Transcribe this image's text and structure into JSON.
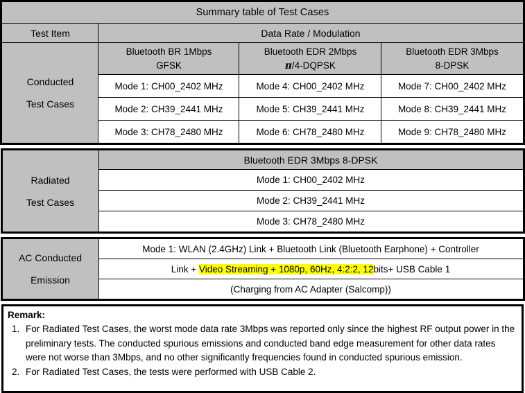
{
  "document": {
    "title": "Summary table of Test Cases"
  },
  "conducted_table": {
    "header": {
      "test_item_label": "Test Item",
      "data_rate_label": "Data Rate / Modulation"
    },
    "row_label": {
      "line1": "Conducted",
      "line2": "Test Cases"
    },
    "columns": [
      {
        "line1": "Bluetooth BR 1Mbps",
        "line2": "GFSK",
        "pi_prefix": false
      },
      {
        "line1": "Bluetooth EDR 2Mbps",
        "line2": "/4-DQPSK",
        "pi_prefix": true
      },
      {
        "line1": "Bluetooth EDR 3Mbps",
        "line2": "8-DPSK",
        "pi_prefix": false
      }
    ],
    "modes": [
      [
        "Mode 1: CH00_2402 MHz",
        "Mode 4: CH00_2402 MHz",
        "Mode 7: CH00_2402 MHz"
      ],
      [
        "Mode 2: CH39_2441 MHz",
        "Mode 5: CH39_2441 MHz",
        "Mode 8: CH39_2441 MHz"
      ],
      [
        "Mode 3: CH78_2480 MHz",
        "Mode 6: CH78_2480 MHz",
        "Mode 9: CH78_2480 MHz"
      ]
    ]
  },
  "radiated_table": {
    "row_label": {
      "line1": "Radiated",
      "line2": "Test Cases"
    },
    "header": "Bluetooth EDR 3Mbps 8-DPSK",
    "modes": [
      "Mode 1: CH00_2402 MHz",
      "Mode 2: CH39_2441 MHz",
      "Mode 3: CH78_2480 MHz"
    ]
  },
  "ac_table": {
    "row_label": {
      "line1": "AC Conducted",
      "line2": "Emission"
    },
    "line1": "Mode 1: WLAN (2.4GHz) Link + Bluetooth Link (Bluetooth Earphone) + Controller",
    "line2_pre": "Link + ",
    "line2_highlight": "Video Streaming + 1080p, 60Hz, 4:2:2, 12",
    "line2_post": "bits+ USB Cable 1",
    "line3": "(Charging from AC Adapter (Salcomp))"
  },
  "remark": {
    "title": "Remark:",
    "items": [
      {
        "number": "1.",
        "text": "For Radiated Test Cases, the worst mode data rate 3Mbps was reported only since the highest RF output power in the preliminary tests. The conducted spurious emissions and conducted band edge measurement for other data rates were not worse than 3Mbps, and no other significantly frequencies found in conducted spurious emission."
      },
      {
        "number": "2.",
        "text": "For Radiated Test Cases, the tests were performed with USB Cable 2."
      }
    ]
  },
  "colors": {
    "header_gray": "#C0C0C0",
    "highlight_yellow": "#FFFF00",
    "border_black": "#000000",
    "page_white": "#FFFFFF"
  }
}
